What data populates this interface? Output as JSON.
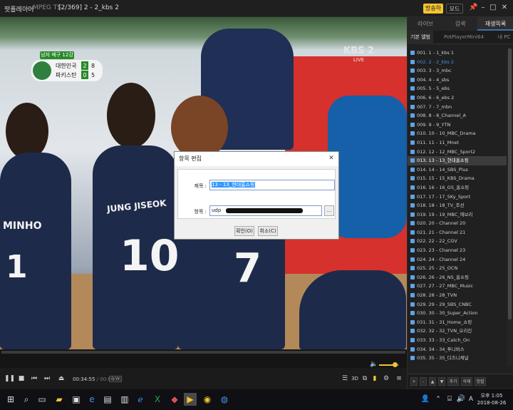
{
  "titlebar": {
    "app_name": "팟플레이어",
    "format": "MPEG TS",
    "now_playing": "[2/369] 2 - 2_kbs 2",
    "broadcast_button": "방송하기",
    "mode_button": "모드"
  },
  "video": {
    "channel_logo": "KBS 2",
    "channel_logo_sub": "LIVE",
    "score_tag": "남자 배구 12강전",
    "team1": "대한민국",
    "team1_sets": "2",
    "team1_points": "8",
    "team2": "파키스탄",
    "team2_sets": "0",
    "team2_points": "5",
    "jersey_name_left": "MINHO",
    "jersey_num_left": "1",
    "jersey_name_center": "JUNG JISEOK",
    "jersey_num_center": "10",
    "jersey_num_right": "7"
  },
  "dialog": {
    "title": "항목 편집",
    "title_label": "제목 :",
    "title_value": "13 - 13_현대홈쇼핑",
    "item_label": "항목 :",
    "item_value_prefix": "udp",
    "browse_label": "...",
    "ok_label": "확인(O)",
    "cancel_label": "취소(C)"
  },
  "controls": {
    "current_time": "00:34:55",
    "total_time": "/ 00:00:00",
    "cw_badge": "S/W",
    "seek_progress": 0.0,
    "volume": 0.8
  },
  "panel": {
    "tabs": [
      "라이브",
      "검색",
      "재생목록"
    ],
    "active_tab": 2,
    "subtabs": [
      "기본 앨범",
      "PotPlayerMini64",
      "내 PC"
    ],
    "active_subtab": 0,
    "playlist": [
      "001. 1 - 1_kbs 1",
      "002. 2 - 2_kbs 2",
      "003. 3 - 3_mbc",
      "004. 4 - 4_sbs",
      "005. 5 - 5_ebs",
      "006. 6 - 6_ebs 2",
      "007. 7 - 7_mbn",
      "008. 8 - 8_Channel_A",
      "009. 9 - 9_YTN",
      "010. 10 - 10_MBC_Drama",
      "011. 11 - 11_Mnet",
      "012. 12 - 12_MBC_Sport2",
      "013. 13 - 13_현대홈쇼핑",
      "014. 14 - 14_SBS_Plus",
      "015. 15 - 15_KBS_Drama",
      "016. 16 - 16_GS_홈쇼핑",
      "017. 17 - 17_SKy_Sport",
      "018. 18 - 18_TV_조선",
      "019. 19 - 19_MBC_에브리",
      "020. 20 - Channel 20",
      "021. 21 - Channel 21",
      "022. 22 - 22_CGV",
      "023. 23 - Channel 23",
      "024. 24 - Channel 24",
      "025. 25 - 25_OCN",
      "026. 26 - 26_NS_홈쇼핑",
      "027. 27 - 27_MBC_Music",
      "028. 28 - 28_TVN",
      "029. 29 - 29_SBS_CNBC",
      "030. 30 - 30_Super_Action",
      "031. 31 - 31_Home_쇼핑",
      "032. 32 - 32_TVN_오리진",
      "033. 33 - 33_Catch_On",
      "034. 34 - 34_투니버스",
      "035. 35 - 35_디즈니채널"
    ],
    "playing_index": 1,
    "selected_index": 12,
    "bottom_buttons": [
      "+",
      "-",
      "▲",
      "▼",
      "추가",
      "삭제",
      "정렬"
    ]
  },
  "taskbar": {
    "time": "오후 1:05",
    "date": "2018-08-26"
  }
}
